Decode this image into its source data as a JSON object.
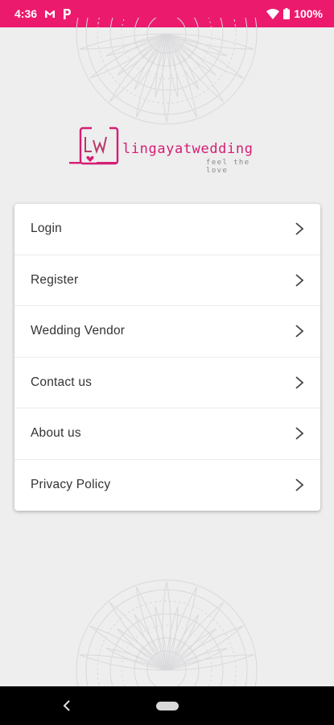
{
  "status_bar": {
    "time": "4:36",
    "notification_icons": [
      "gmail-icon",
      "parking-icon"
    ],
    "system_icons": [
      "wifi-icon",
      "battery-icon"
    ],
    "battery": "100%"
  },
  "brand": {
    "name": "lingayatwedding",
    "tagline": "feel the love",
    "primary_color": "#ec1a6d"
  },
  "menu": {
    "items": [
      {
        "label": "Login",
        "icon": "chevron-right-icon"
      },
      {
        "label": "Register",
        "icon": "chevron-right-icon"
      },
      {
        "label": "Wedding Vendor",
        "icon": "chevron-right-icon"
      },
      {
        "label": "Contact us",
        "icon": "chevron-right-icon"
      },
      {
        "label": "About us",
        "icon": "chevron-right-icon"
      },
      {
        "label": "Privacy Policy",
        "icon": "chevron-right-icon"
      }
    ]
  },
  "nav_bar": {
    "icons": [
      "back-icon",
      "home-pill-icon"
    ]
  }
}
